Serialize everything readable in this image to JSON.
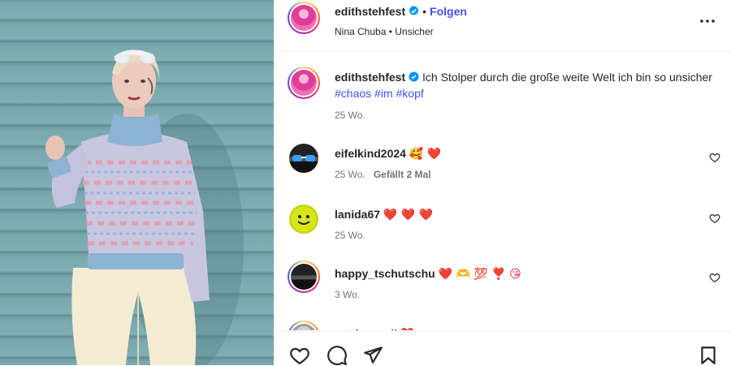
{
  "post": {
    "author": "edithstehfest",
    "dot": "•",
    "follow_label": "Folgen",
    "music": "Nina Chuba",
    "music_sep": "•",
    "song": "Unsicher"
  },
  "caption": {
    "username": "edithstehfest",
    "text": "Ich Stolper durch die große weite Welt ich bin so unsicher ",
    "hashtags": [
      "#chaos",
      "#im",
      "#kopf"
    ],
    "time": "25 Wo."
  },
  "comments": [
    {
      "username": "eifelkind2024",
      "text": "🥰 ❤️",
      "time": "25 Wo.",
      "likes": "Gefällt 2 Mal",
      "avatar": "sunglasses-avatar"
    },
    {
      "username": "lanida67",
      "text": "❤️ ❤️ ❤️",
      "time": "25 Wo.",
      "likes": "",
      "avatar": "smiley-badge-avatar"
    },
    {
      "username": "happy_tschutschu",
      "text": "❤️ 🫶 💯 ❣️ 😘",
      "time": "3 Wo.",
      "likes": "",
      "avatar": "story-ring-avatar"
    },
    {
      "username": "pattina_sall",
      "text": "❤️",
      "time": "",
      "likes": "",
      "avatar": "partial-avatar"
    }
  ],
  "icons": {
    "header_more": "more-horizontal-icon",
    "verified": "verified-badge-icon",
    "like": "heart-outline-icon",
    "comment": "comment-bubble-icon",
    "share": "paper-plane-icon",
    "save": "bookmark-icon"
  },
  "colors": {
    "link_blue": "#4150f7",
    "verified_blue": "#0095f6",
    "muted": "#737373"
  }
}
